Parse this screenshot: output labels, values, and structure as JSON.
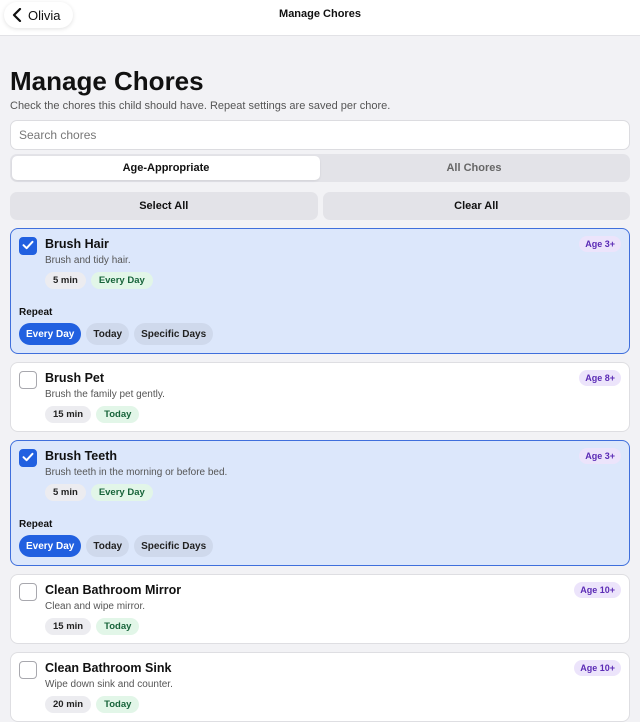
{
  "nav": {
    "back_label": "Olivia",
    "title": "Manage Chores"
  },
  "page": {
    "title": "Manage Chores",
    "subtitle": "Check the chores this child should have. Repeat settings are saved per chore."
  },
  "search": {
    "placeholder": "Search chores",
    "value": ""
  },
  "tabs": [
    {
      "label": "Age-Appropriate",
      "active": true
    },
    {
      "label": "All Chores",
      "active": false
    }
  ],
  "bulk": {
    "select_all": "Select All",
    "clear_all": "Clear All"
  },
  "repeat": {
    "label": "Repeat",
    "options": [
      "Every Day",
      "Today",
      "Specific Days"
    ]
  },
  "chores": [
    {
      "name": "Brush Hair",
      "desc": "Brush and tidy hair.",
      "time": "5 min",
      "freq": "Every Day",
      "age": "Age 3+",
      "checked": true,
      "repeat_selected": "Every Day"
    },
    {
      "name": "Brush Pet",
      "desc": "Brush the family pet gently.",
      "time": "15 min",
      "freq": "Today",
      "age": "Age 8+",
      "checked": false
    },
    {
      "name": "Brush Teeth",
      "desc": "Brush teeth in the morning or before bed.",
      "time": "5 min",
      "freq": "Every Day",
      "age": "Age 3+",
      "checked": true,
      "repeat_selected": "Every Day"
    },
    {
      "name": "Clean Bathroom Mirror",
      "desc": "Clean and wipe mirror.",
      "time": "15 min",
      "freq": "Today",
      "age": "Age 10+",
      "checked": false
    },
    {
      "name": "Clean Bathroom Sink",
      "desc": "Wipe down sink and counter.",
      "time": "20 min",
      "freq": "Today",
      "age": "Age 10+",
      "checked": false
    }
  ],
  "colors": {
    "accent": "#2160e0",
    "selected_card_bg": "#dce7fb",
    "age_badge_bg": "#ece4fb",
    "age_badge_text": "#5b2bb5",
    "freq_tag_bg": "#e2f6e8",
    "freq_tag_text": "#17643a"
  },
  "icons": {
    "back": "chevron-left-icon",
    "check": "checkmark-icon"
  }
}
